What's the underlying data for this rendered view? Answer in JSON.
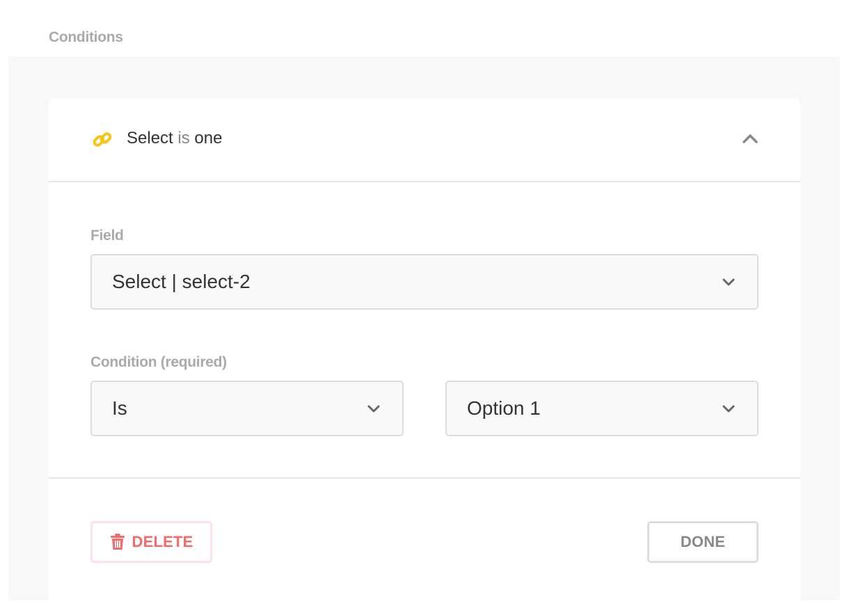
{
  "section": {
    "label": "Conditions"
  },
  "condition_card": {
    "title_field": "Select",
    "title_operator": "is",
    "title_value": "one",
    "field": {
      "label": "Field",
      "selected": "Select | select-2"
    },
    "condition": {
      "label": "Condition (required)",
      "operator_selected": "Is",
      "value_selected": "Option 1"
    },
    "actions": {
      "delete_label": "DELETE",
      "done_label": "DONE"
    }
  },
  "icons": {
    "link": "link-icon",
    "collapse": "chevron-up-icon",
    "dropdown": "chevron-down-icon",
    "delete": "trash-icon"
  },
  "colors": {
    "link_icon": "#f5c518",
    "delete": "#f26a6a",
    "delete_border": "#fde1e4",
    "muted_text": "#aaaaaa"
  }
}
